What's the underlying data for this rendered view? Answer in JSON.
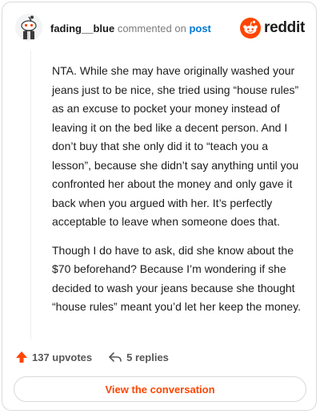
{
  "comment": {
    "username": "fading__blue",
    "commented_text": "commented on",
    "post_link": "post",
    "paragraphs": [
      "NTA. While she may have originally washed your jeans just to be nice, she tried using “house rules” as an excuse to pocket your money instead of leaving it on the bed like a decent person. And I don’t buy that she only did it to “teach you a lesson”, because she didn’t say anything until you confronted her about the money and only gave it back when you argued with her. It’s perfectly acceptable to leave when someone does that.",
      "Though I do have to ask, did she know about the $70 beforehand? Because I’m wondering if she decided to wash your jeans because she thought “house rules” meant you’d let her keep the money."
    ]
  },
  "brand": {
    "wordmark": "reddit",
    "icon": "reddit-snoo-icon",
    "color": "#ff4500"
  },
  "actions": {
    "upvotes": "137 upvotes",
    "upvote_icon": "upvote-arrow-icon",
    "replies": "5 replies",
    "reply_icon": "reply-arrow-icon"
  },
  "cta": {
    "label": "View the conversation"
  },
  "colors": {
    "accent": "#ff4500",
    "link": "#0079d3",
    "muted": "#7c7c7c"
  }
}
